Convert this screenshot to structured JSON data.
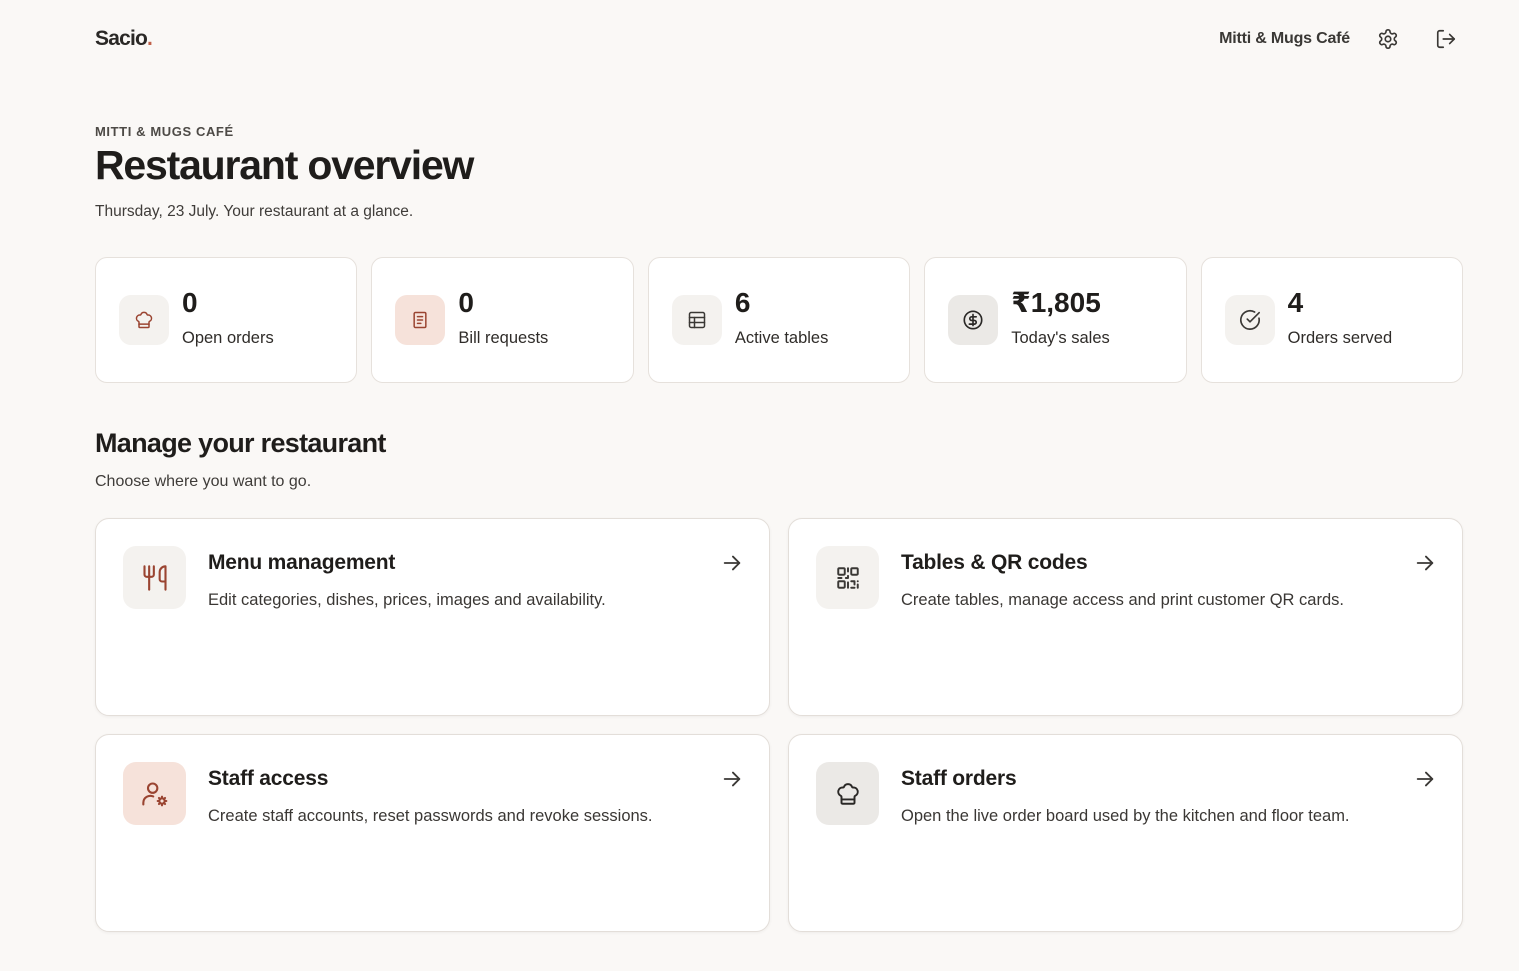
{
  "header": {
    "brand": "Sacio",
    "brand_dot": ".",
    "restaurant_name": "Mitti & Mugs Café",
    "settings_icon": "gear-icon",
    "logout_icon": "logout-icon"
  },
  "page": {
    "eyebrow": "MITTI & MUGS CAFÉ",
    "title": "Restaurant overview",
    "subtitle": "Thursday, 23 July. Your restaurant at a glance."
  },
  "stats": [
    {
      "value": "0",
      "label": "Open orders",
      "icon": "chef-hat-icon"
    },
    {
      "value": "0",
      "label": "Bill requests",
      "icon": "receipt-icon"
    },
    {
      "value": "6",
      "label": "Active tables",
      "icon": "table-icon"
    },
    {
      "value": "₹1,805",
      "label": "Today's sales",
      "icon": "currency-icon"
    },
    {
      "value": "4",
      "label": "Orders served",
      "icon": "check-circle-icon"
    }
  ],
  "manage": {
    "title": "Manage your restaurant",
    "subtitle": "Choose where you want to go.",
    "cards": [
      {
        "title": "Menu management",
        "description": "Edit categories, dishes, prices, images and availability.",
        "icon": "utensils-icon"
      },
      {
        "title": "Tables & QR codes",
        "description": "Create tables, manage access and print customer QR cards.",
        "icon": "qr-code-icon"
      },
      {
        "title": "Staff access",
        "description": "Create staff accounts, reset passwords and revoke sessions.",
        "icon": "user-cog-icon"
      },
      {
        "title": "Staff orders",
        "description": "Open the live order board used by the kitchen and floor team.",
        "icon": "chef-hat-icon"
      }
    ]
  },
  "colors": {
    "accent": "#c0614a",
    "icon_accent": "#9a4431",
    "background": "#faf8f6"
  }
}
